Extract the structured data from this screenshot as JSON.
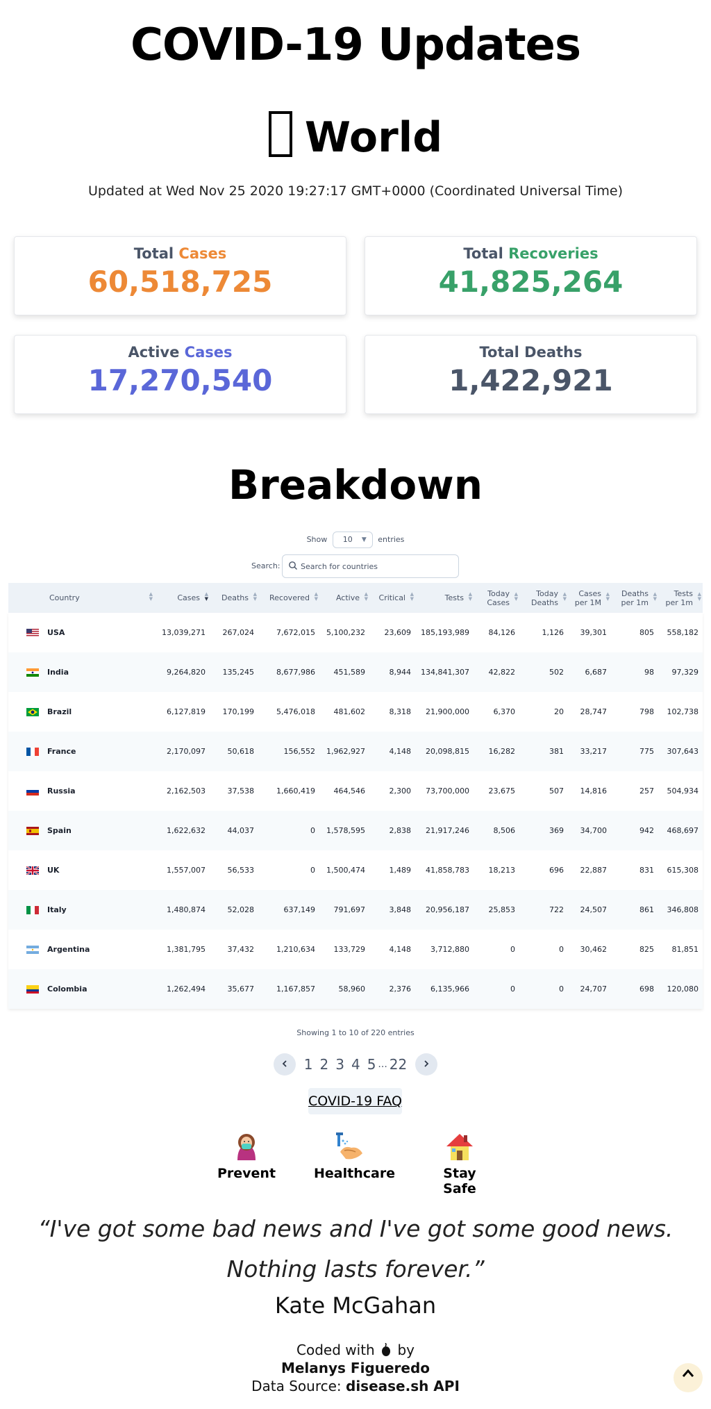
{
  "header": {
    "title": "COVID-19 Updates",
    "region": "World",
    "updated": "Updated at Wed Nov 25 2020 19:27:17 GMT+0000 (Coordinated Universal Time)"
  },
  "stats": {
    "total_cases": {
      "label_a": "Total ",
      "label_b": "Cases",
      "value": "60,518,725",
      "color": "#ed8936"
    },
    "total_recoveries": {
      "label_a": "Total ",
      "label_b": "Recoveries",
      "value": "41,825,264",
      "color": "#38a169"
    },
    "active_cases": {
      "label_a": "Active ",
      "label_b": "Cases",
      "value": "17,270,540",
      "color": "#5a67d8"
    },
    "total_deaths": {
      "label": "Total Deaths",
      "value": "1,422,921",
      "color": "#4a5568"
    }
  },
  "breakdown": {
    "title": "Breakdown",
    "show_label": "Show",
    "entries_label": "entries",
    "page_size": "10",
    "search_label": "Search:",
    "search_placeholder": "Search for countries",
    "columns": [
      "Country",
      "Cases",
      "Deaths",
      "Recovered",
      "Active",
      "Critical",
      "Tests",
      "Today Cases",
      "Today Deaths",
      "Cases per 1M",
      "Deaths per 1m",
      "Tests per 1m"
    ],
    "rows": [
      {
        "country": "USA",
        "flag": "us",
        "cells": [
          "13,039,271",
          "267,024",
          "7,672,015",
          "5,100,232",
          "23,609",
          "185,193,989",
          "84,126",
          "1,126",
          "39,301",
          "805",
          "558,182"
        ]
      },
      {
        "country": "India",
        "flag": "in",
        "cells": [
          "9,264,820",
          "135,245",
          "8,677,986",
          "451,589",
          "8,944",
          "134,841,307",
          "42,822",
          "502",
          "6,687",
          "98",
          "97,329"
        ]
      },
      {
        "country": "Brazil",
        "flag": "br",
        "cells": [
          "6,127,819",
          "170,199",
          "5,476,018",
          "481,602",
          "8,318",
          "21,900,000",
          "6,370",
          "20",
          "28,747",
          "798",
          "102,738"
        ]
      },
      {
        "country": "France",
        "flag": "fr",
        "cells": [
          "2,170,097",
          "50,618",
          "156,552",
          "1,962,927",
          "4,148",
          "20,098,815",
          "16,282",
          "381",
          "33,217",
          "775",
          "307,643"
        ]
      },
      {
        "country": "Russia",
        "flag": "ru",
        "cells": [
          "2,162,503",
          "37,538",
          "1,660,419",
          "464,546",
          "2,300",
          "73,700,000",
          "23,675",
          "507",
          "14,816",
          "257",
          "504,934"
        ]
      },
      {
        "country": "Spain",
        "flag": "es",
        "cells": [
          "1,622,632",
          "44,037",
          "0",
          "1,578,595",
          "2,838",
          "21,917,246",
          "8,506",
          "369",
          "34,700",
          "942",
          "468,697"
        ]
      },
      {
        "country": "UK",
        "flag": "gb",
        "cells": [
          "1,557,007",
          "56,533",
          "0",
          "1,500,474",
          "1,489",
          "41,858,783",
          "18,213",
          "696",
          "22,887",
          "831",
          "615,308"
        ]
      },
      {
        "country": "Italy",
        "flag": "it",
        "cells": [
          "1,480,874",
          "52,028",
          "637,149",
          "791,697",
          "3,848",
          "20,956,187",
          "25,853",
          "722",
          "24,507",
          "861",
          "346,808"
        ]
      },
      {
        "country": "Argentina",
        "flag": "ar",
        "cells": [
          "1,381,795",
          "37,432",
          "1,210,634",
          "133,729",
          "4,148",
          "3,712,880",
          "0",
          "0",
          "30,462",
          "825",
          "81,851"
        ]
      },
      {
        "country": "Colombia",
        "flag": "co",
        "cells": [
          "1,262,494",
          "35,677",
          "1,167,857",
          "58,960",
          "2,376",
          "6,135,966",
          "0",
          "0",
          "24,707",
          "698",
          "120,080"
        ]
      }
    ],
    "showing": "Showing 1 to 10 of 220 entries",
    "pages": [
      "1",
      "2",
      "3",
      "4",
      "5"
    ],
    "ellipsis": "...",
    "last_page": "22",
    "current_page": "1"
  },
  "faq": {
    "label": "COVID-19 FAQ",
    "links": [
      {
        "label": "Prevent",
        "icon": "masked-person-icon"
      },
      {
        "label": "Healthcare",
        "icon": "hand-washing-icon"
      },
      {
        "label": "Stay Safe",
        "icon": "house-icon"
      }
    ]
  },
  "quote": {
    "text": "“I've got some bad news and I've got some good news. Nothing lasts forever.”",
    "author": "Kate McGahan"
  },
  "footer": {
    "coded_with": "Coded with",
    "by": "by",
    "author": "Melanys Figueredo",
    "source_label": "Data Source:",
    "source": "disease.sh API",
    "icon": "coffee-icon"
  },
  "scroll_top_icon": "caret-up-icon"
}
